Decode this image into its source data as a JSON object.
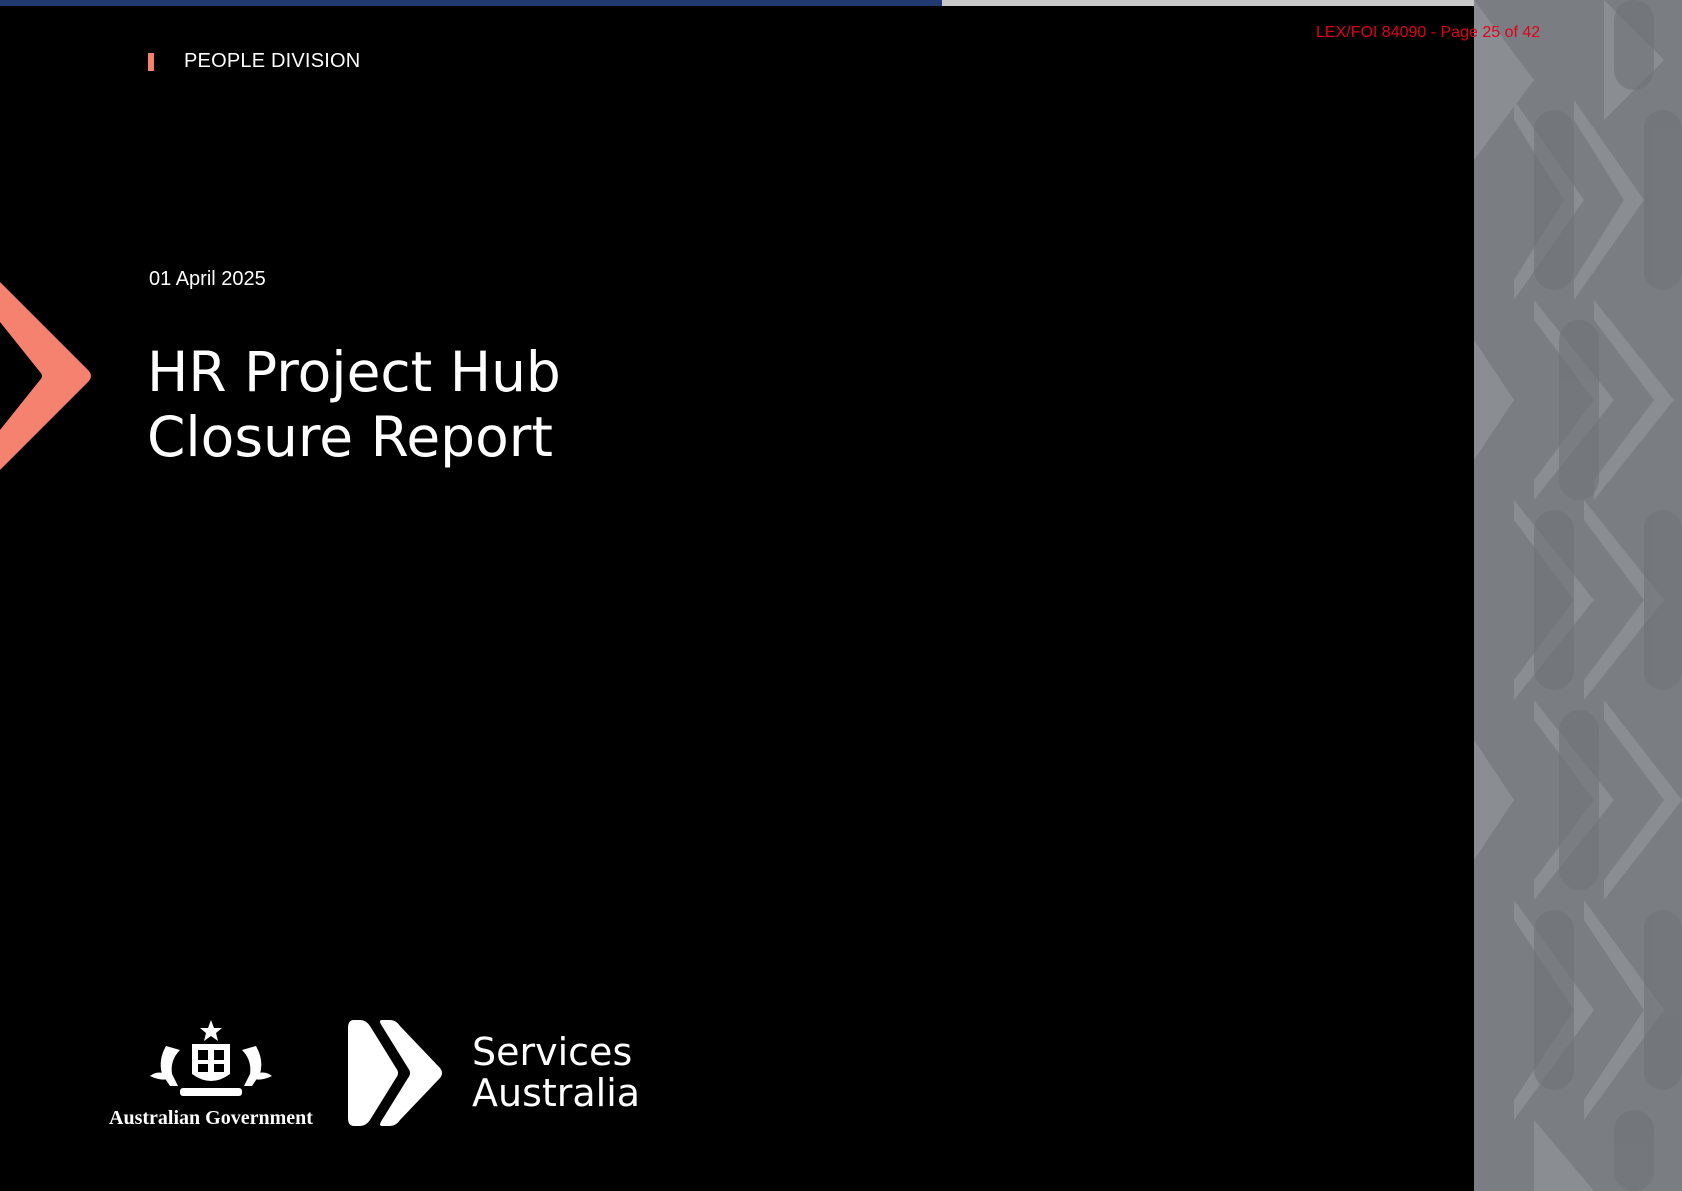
{
  "header": {
    "stamp": "LEX/FOI 84090 - Page 25 of 42",
    "division": "PEOPLE DIVISION"
  },
  "cover": {
    "date": "01 April 2025",
    "title_line1": "HR Project Hub",
    "title_line2": "Closure Report"
  },
  "footer": {
    "government": "Australian Government",
    "agency_line1": "Services",
    "agency_line2": "Australia"
  },
  "colors": {
    "background": "#000000",
    "accent": "#f5826f",
    "stamp": "#e0001a",
    "panel": "#7a7e82",
    "stripe": "#1f3a6e"
  }
}
